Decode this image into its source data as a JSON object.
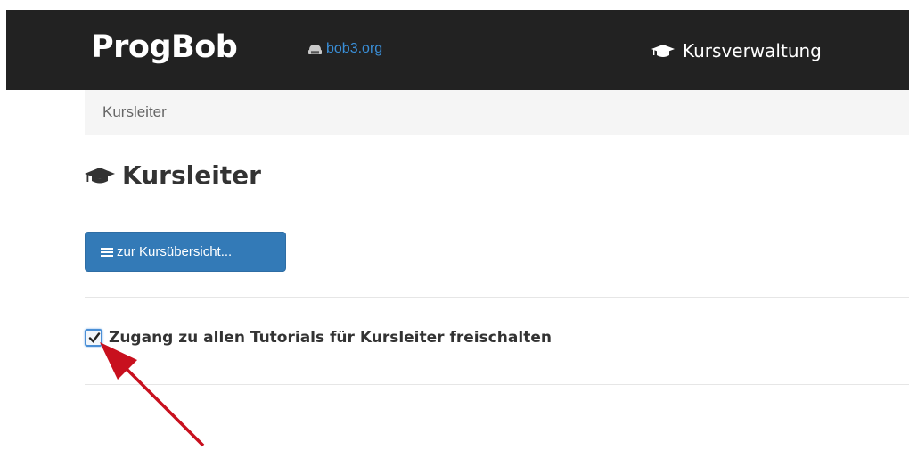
{
  "navbar": {
    "brand": "ProgBob",
    "site_link": "bob3.org",
    "site_link_icon": "robot-icon",
    "menu_item": "Kursverwaltung",
    "menu_item_icon": "graduation-cap-icon",
    "background": "#222222"
  },
  "breadcrumb": {
    "current": "Kursleiter"
  },
  "page": {
    "title": "Kursleiter",
    "title_icon": "graduation-cap-icon"
  },
  "overview_button": {
    "label": "zur Kursübersicht...",
    "icon": "list-icon",
    "color": "#337ab7"
  },
  "access_option": {
    "label": "Zugang zu allen Tutorials für Kursleiter freischalten",
    "checked": true
  },
  "annotation": {
    "arrow_color": "#c8101e"
  }
}
